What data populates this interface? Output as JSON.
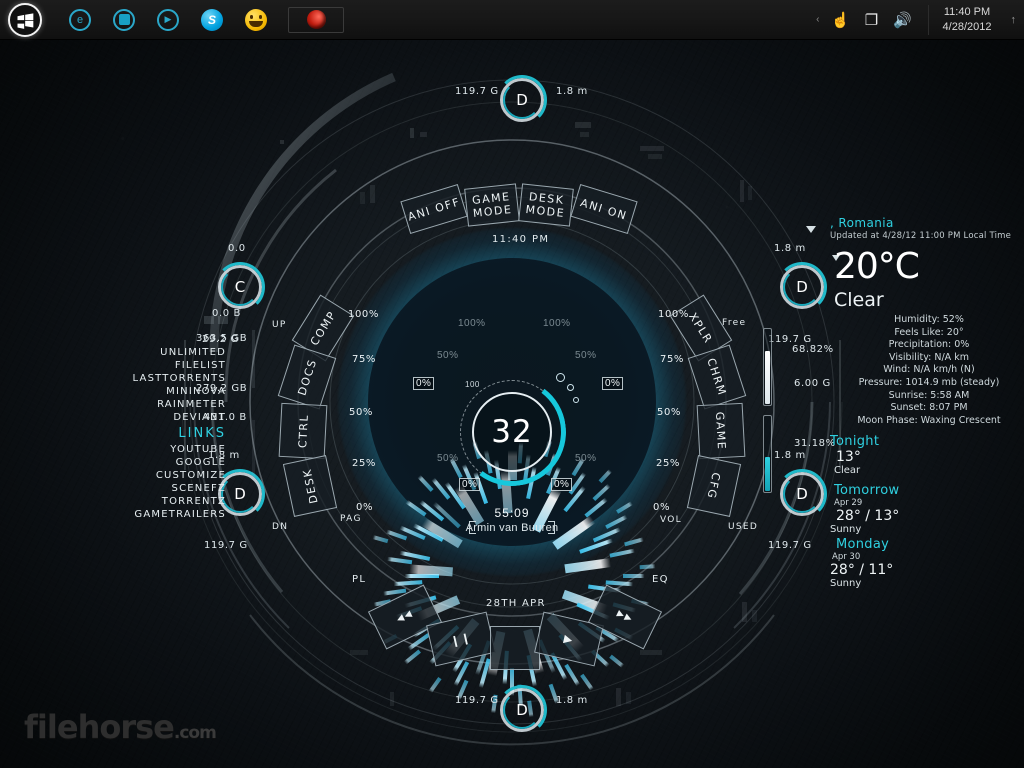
{
  "taskbar": {
    "start_label": "Start",
    "icons": [
      {
        "name": "ie-icon",
        "label": "e"
      },
      {
        "name": "explorer-icon",
        "label": ""
      },
      {
        "name": "media-player-icon",
        "label": "▶"
      },
      {
        "name": "skype-icon",
        "label": "S"
      },
      {
        "name": "smiley-icon",
        "label": ""
      },
      {
        "name": "opera-icon",
        "label": ""
      }
    ],
    "tray": {
      "chevron": "‹",
      "icons": [
        {
          "name": "hand-icon",
          "label": "☝"
        },
        {
          "name": "network-icon",
          "label": "❐"
        },
        {
          "name": "volume-icon",
          "label": "🔊"
        }
      ],
      "time": "11:40 PM",
      "date": "4/28/2012",
      "up_arrow": "↑"
    }
  },
  "clock": {
    "time": "11:40",
    "ampm": "PM",
    "date": "28TH  APR"
  },
  "mode_buttons": [
    {
      "name": "ani-off-button",
      "label": "ANI OFF"
    },
    {
      "name": "game-mode-button",
      "line1": "GAME",
      "line2": "MODE"
    },
    {
      "name": "desk-mode-button",
      "line1": "DESK",
      "line2": "MODE"
    },
    {
      "name": "ani-on-button",
      "label": "ANI ON"
    }
  ],
  "left_buttons": [
    {
      "name": "comp-button",
      "label": "COMP"
    },
    {
      "name": "docs-button",
      "label": "DOCS"
    },
    {
      "name": "ctrl-button",
      "label": "CTRL"
    },
    {
      "name": "desk-button",
      "label": "DESK"
    }
  ],
  "right_buttons": [
    {
      "name": "xplr-button",
      "label": "XPLR"
    },
    {
      "name": "chrm-button",
      "label": "CHRM"
    },
    {
      "name": "game-button",
      "label": "GAME"
    },
    {
      "name": "cfg-button",
      "label": "CFG"
    }
  ],
  "scale_labels": {
    "up": "UP",
    "dn": "DN",
    "pag": "PAG",
    "vol": "VOL",
    "free": "Free",
    "used": "USED",
    "pl": "PL",
    "eq": "EQ",
    "left": [
      "100%",
      "75%",
      "50%",
      "25%",
      "0%"
    ],
    "right": [
      "100%",
      "75%",
      "50%",
      "25%",
      "0%"
    ],
    "inner": [
      "100%",
      "50%",
      "0%"
    ]
  },
  "transport": [
    {
      "name": "previous-button",
      "label": "◀◀"
    },
    {
      "name": "pause-button",
      "label": "❙❙"
    },
    {
      "name": "stop-button",
      "label": ""
    },
    {
      "name": "play-button",
      "label": "▶"
    },
    {
      "name": "next-button",
      "label": "▶▶"
    }
  ],
  "center_gauge": {
    "value": "32",
    "scale_max": "100"
  },
  "now_playing": {
    "time": "55:09",
    "artist": "Armin van Buuren"
  },
  "drives": [
    {
      "name": "drive-d-top",
      "letter": "D",
      "size": "119.7 G",
      "rate": "1.8 m"
    },
    {
      "name": "drive-c-left",
      "letter": "C",
      "size": "29.2 G",
      "rate": "0.0"
    },
    {
      "name": "drive-d-left",
      "letter": "D",
      "size": "119.7 G",
      "rate": "1.8 m"
    },
    {
      "name": "drive-d-right-upper",
      "letter": "D",
      "size": "119.7 G",
      "rate": "1.8 m"
    },
    {
      "name": "drive-d-right-lower",
      "letter": "D",
      "size": "119.7 G",
      "rate": "1.8 m"
    },
    {
      "name": "drive-d-bottom",
      "letter": "D",
      "size": "119.7 G",
      "rate": "1.8 m"
    }
  ],
  "net_stats": {
    "down": "0.0 B",
    "total_down": "363.5 GB",
    "up_total": "279.2 GB",
    "up": "431.0 B"
  },
  "mem_stats": {
    "free_pct": "68.82%",
    "used_gb": "6.00 G",
    "used_pct": "31.18%"
  },
  "links": {
    "top": [
      "UNLIMITED",
      "FILELIST",
      "LASTTORRENTS",
      "MININOVA",
      "RAINMETER",
      "DEVIANT"
    ],
    "header": "LINKS",
    "bottom": [
      "YOUTUBE",
      "GOOGLE",
      "CUSTOMIZE",
      "SCENEFZ",
      "TORRENTZ",
      "GAMETRAILERS"
    ]
  },
  "weather": {
    "location": ", Romania",
    "updated": "Updated at 4/28/12 11:00 PM Local Time",
    "temperature": "20°C",
    "condition": "Clear",
    "details": [
      "Humidity: 52%",
      "Feels Like: 20°",
      "Precipitation: 0%",
      "Visibility: N/A km",
      "Wind: N/A km/h (N)",
      "Pressure: 1014.9 mb (steady)",
      "Sunrise: 5:58 AM",
      "Sunset: 8:07 PM",
      "Moon Phase: Waxing Crescent"
    ],
    "forecast": [
      {
        "title": "Tonight",
        "date": "",
        "temp": "13°",
        "desc": "Clear"
      },
      {
        "title": "Tomorrow",
        "date": "Apr 29",
        "temp": "28° / 13°",
        "desc": "Sunny"
      },
      {
        "title": "Monday",
        "date": "Apr 30",
        "temp": "28° / 11°",
        "desc": "Sunny"
      }
    ]
  },
  "watermark": {
    "text": "filehorse",
    "suffix": ".com"
  },
  "colors": {
    "accent": "#2fd0e0",
    "glow": "#39c8f5",
    "text": "#e9eef0",
    "taskbar": "#171717"
  }
}
